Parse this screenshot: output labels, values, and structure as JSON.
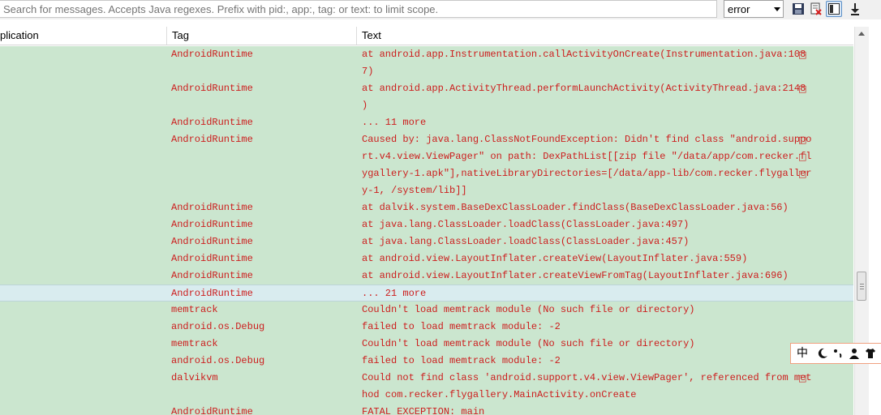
{
  "toolbar": {
    "search_placeholder": "Search for messages. Accepts Java regexes. Prefix with pid:, app:, tag: or text: to limit scope.",
    "log_level": "error",
    "icons": [
      "save-icon",
      "clear-log-icon",
      "toggle-panel-icon",
      "scroll-lock-icon"
    ]
  },
  "columns": {
    "application": "plication",
    "tag": "Tag",
    "text": "Text"
  },
  "colors": {
    "row_bg": "#cbe6cf",
    "selected_row_bg": "#d9ecef",
    "log_text": "#cc1d1d"
  },
  "wrap_glyph": "□",
  "rows": [
    {
      "tag": "AndroidRuntime",
      "lines": [
        "at android.app.Instrumentation.callActivityOnCreate(Instrumentation.java:108",
        "7)"
      ],
      "wrapped": [
        true
      ]
    },
    {
      "tag": "AndroidRuntime",
      "lines": [
        "at android.app.ActivityThread.performLaunchActivity(ActivityThread.java:2148",
        ")"
      ],
      "wrapped": [
        true
      ]
    },
    {
      "tag": "AndroidRuntime",
      "lines": [
        "... 11 more"
      ],
      "wrapped": []
    },
    {
      "tag": "AndroidRuntime",
      "lines": [
        "Caused by: java.lang.ClassNotFoundException: Didn't find class \"android.suppo",
        "rt.v4.view.ViewPager\" on path: DexPathList[[zip file \"/data/app/com.recker.fl",
        "ygallery-1.apk\"],nativeLibraryDirectories=[/data/app-lib/com.recker.flygaller",
        "y-1, /system/lib]]"
      ],
      "wrapped": [
        true,
        true,
        true
      ]
    },
    {
      "tag": "AndroidRuntime",
      "lines": [
        "at dalvik.system.BaseDexClassLoader.findClass(BaseDexClassLoader.java:56)"
      ],
      "wrapped": []
    },
    {
      "tag": "AndroidRuntime",
      "lines": [
        "at java.lang.ClassLoader.loadClass(ClassLoader.java:497)"
      ],
      "wrapped": []
    },
    {
      "tag": "AndroidRuntime",
      "lines": [
        "at java.lang.ClassLoader.loadClass(ClassLoader.java:457)"
      ],
      "wrapped": []
    },
    {
      "tag": "AndroidRuntime",
      "lines": [
        "at android.view.LayoutInflater.createView(LayoutInflater.java:559)"
      ],
      "wrapped": []
    },
    {
      "tag": "AndroidRuntime",
      "lines": [
        "at android.view.LayoutInflater.createViewFromTag(LayoutInflater.java:696)"
      ],
      "wrapped": []
    },
    {
      "tag": "AndroidRuntime",
      "lines": [
        "... 21 more"
      ],
      "wrapped": [],
      "selected": true
    },
    {
      "tag": "memtrack",
      "lines": [
        "Couldn't load memtrack module (No such file or directory)"
      ],
      "wrapped": []
    },
    {
      "tag": "android.os.Debug",
      "lines": [
        "failed to load memtrack module: -2"
      ],
      "wrapped": []
    },
    {
      "tag": "memtrack",
      "lines": [
        "Couldn't load memtrack module (No such file or directory)"
      ],
      "wrapped": []
    },
    {
      "tag": "android.os.Debug",
      "lines": [
        "failed to load memtrack module: -2"
      ],
      "wrapped": []
    },
    {
      "tag": "dalvikvm",
      "lines": [
        "Could not find class 'android.support.v4.view.ViewPager', referenced from met",
        "hod com.recker.flygallery.MainActivity.onCreate"
      ],
      "wrapped": [
        true
      ]
    },
    {
      "tag": "AndroidRuntime",
      "lines": [
        "FATAL EXCEPTION: main"
      ],
      "wrapped": []
    }
  ],
  "ime": {
    "label": "中",
    "icons": [
      "moon-icon",
      "punctuation-icon",
      "user-icon",
      "shirt-icon"
    ]
  }
}
